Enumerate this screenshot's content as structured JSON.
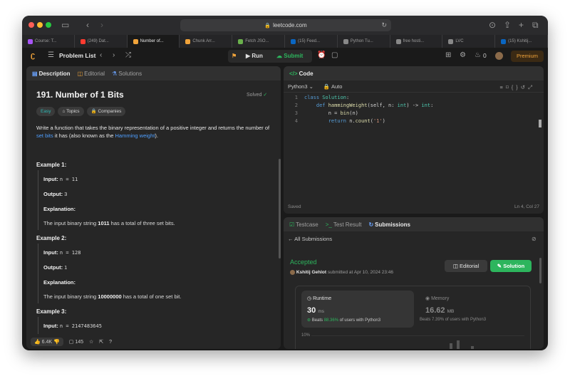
{
  "browser": {
    "url": "leetcode.com",
    "tabs": [
      {
        "label": "Course: T...",
        "color": "#a855f7"
      },
      {
        "label": "(249) Dat...",
        "color": "#ff3b30"
      },
      {
        "label": "Number of...",
        "color": "#f0a33a",
        "active": true
      },
      {
        "label": "Chunk Arr...",
        "color": "#f0a33a"
      },
      {
        "label": "Fetch JSO...",
        "color": "#6ab04c"
      },
      {
        "label": "(15) Feed...",
        "color": "#0a66c2"
      },
      {
        "label": "Python Tu...",
        "color": "#888888"
      },
      {
        "label": "free hosti...",
        "color": "#888888"
      },
      {
        "label": "LVC",
        "color": "#888888"
      },
      {
        "label": "(15) Kshitij...",
        "color": "#0a66c2"
      }
    ]
  },
  "nav": {
    "problem_list": "Problem List",
    "run": "Run",
    "submit": "Submit",
    "streak": "0",
    "premium": "Premium"
  },
  "left": {
    "tabs": {
      "description": "Description",
      "editorial": "Editorial",
      "solutions": "Solutions"
    },
    "title": "191. Number of 1 Bits",
    "solved": "Solved",
    "chips": {
      "difficulty": "Easy",
      "topics": "Topics",
      "companies": "Companies"
    },
    "statement": {
      "p1": "Write a function that takes the binary representation of a positive integer and returns the number of ",
      "link1": "set bits",
      "p2": " it has (also known as the ",
      "link2": "Hamming weight",
      "p3": ")."
    },
    "examples": [
      {
        "heading": "Example 1:",
        "input_label": "Input:",
        "input": "n = 11",
        "output_label": "Output:",
        "output": "3",
        "exp_label": "Explanation:",
        "exp_pre": "The input binary string ",
        "exp_bold": "1011",
        "exp_post": " has a total of three set bits."
      },
      {
        "heading": "Example 2:",
        "input_label": "Input:",
        "input": "n = 128",
        "output_label": "Output:",
        "output": "1",
        "exp_label": "Explanation:",
        "exp_pre": "The input binary string ",
        "exp_bold": "10000000",
        "exp_post": " has a total of one set bit."
      },
      {
        "heading": "Example 3:",
        "input_label": "Input:",
        "input": "n = 2147483645"
      }
    ],
    "footer": {
      "likes": "6.4K",
      "comments": "145"
    }
  },
  "code": {
    "title": "Code",
    "language": "Python3",
    "mode": "Auto",
    "lines": [
      {
        "num": "1",
        "parts": [
          {
            "t": "class ",
            "c": "kw"
          },
          {
            "t": "Solution",
            "c": "ty"
          },
          {
            "t": ":",
            "c": ""
          }
        ]
      },
      {
        "num": "2",
        "parts": [
          {
            "t": "    def ",
            "c": "kw"
          },
          {
            "t": "hammingWeight",
            "c": "fn"
          },
          {
            "t": "(self, n: ",
            "c": ""
          },
          {
            "t": "int",
            "c": "ty"
          },
          {
            "t": ") -> ",
            "c": ""
          },
          {
            "t": "int",
            "c": "ty"
          },
          {
            "t": ":",
            "c": ""
          }
        ]
      },
      {
        "num": "3",
        "parts": [
          {
            "t": "        n = ",
            "c": ""
          },
          {
            "t": "bin",
            "c": "fn"
          },
          {
            "t": "(n)",
            "c": ""
          }
        ]
      },
      {
        "num": "4",
        "parts": [
          {
            "t": "        return ",
            "c": "kw"
          },
          {
            "t": "n.",
            "c": ""
          },
          {
            "t": "count",
            "c": "fn"
          },
          {
            "t": "(",
            "c": ""
          },
          {
            "t": "'1'",
            "c": "st"
          },
          {
            "t": ")",
            "c": ""
          }
        ]
      }
    ],
    "status_left": "Saved",
    "status_right": "Ln 4, Col 27"
  },
  "result": {
    "tabs": {
      "testcase": "Testcase",
      "test_result": "Test Result",
      "submissions": "Submissions"
    },
    "back_label": "All Submissions",
    "status": "Accepted",
    "author": "Kshitij Gehlot",
    "submitted": "submitted at Apr 10, 2024 23:46",
    "editorial_btn": "Editorial",
    "solution_btn": "Solution",
    "runtime": {
      "label": "Runtime",
      "value": "30",
      "unit": "ms",
      "beats_pre": "Beats ",
      "beats_pct": "88.36%",
      "beats_post": " of users with Python3"
    },
    "memory": {
      "label": "Memory",
      "value": "16.62",
      "unit": "MB",
      "beats_pre": "Beats ",
      "beats_pct": "7.39%",
      "beats_post": " of users with Python3"
    },
    "chart_tick": "10%"
  }
}
